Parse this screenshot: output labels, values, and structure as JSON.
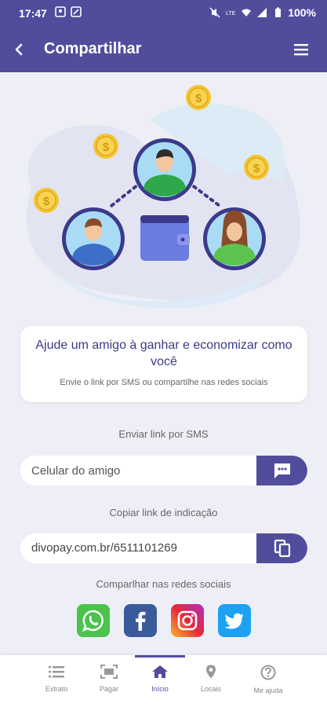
{
  "status_bar": {
    "time": "17:47",
    "battery": "100%"
  },
  "app_bar": {
    "title": "Compartilhar"
  },
  "card": {
    "title": "Ajude um amigo à ganhar e economizar como você",
    "subtitle": "Envie o link por SMS ou compartilhe nas redes sociais"
  },
  "sms": {
    "label": "Enviar link por SMS",
    "placeholder": "Celular do amigo"
  },
  "referral": {
    "label": "Copiar link de indicação",
    "link": "divopay.com.br/6511101269"
  },
  "social": {
    "label": "Comparlhar nas redes sociais"
  },
  "nav": {
    "items": [
      {
        "label": "Extrato",
        "icon": "list-icon"
      },
      {
        "label": "Pagar",
        "icon": "scan-icon"
      },
      {
        "label": "Início",
        "icon": "home-icon"
      },
      {
        "label": "Locais",
        "icon": "location-icon"
      },
      {
        "label": "Me ajuda",
        "icon": "help-icon"
      }
    ],
    "active_index": 2
  },
  "colors": {
    "brand": "#514d9c",
    "background": "#eeeff6",
    "whatsapp": "#4bc34d",
    "facebook": "#3b5a9a",
    "twitter": "#1da1f2"
  }
}
